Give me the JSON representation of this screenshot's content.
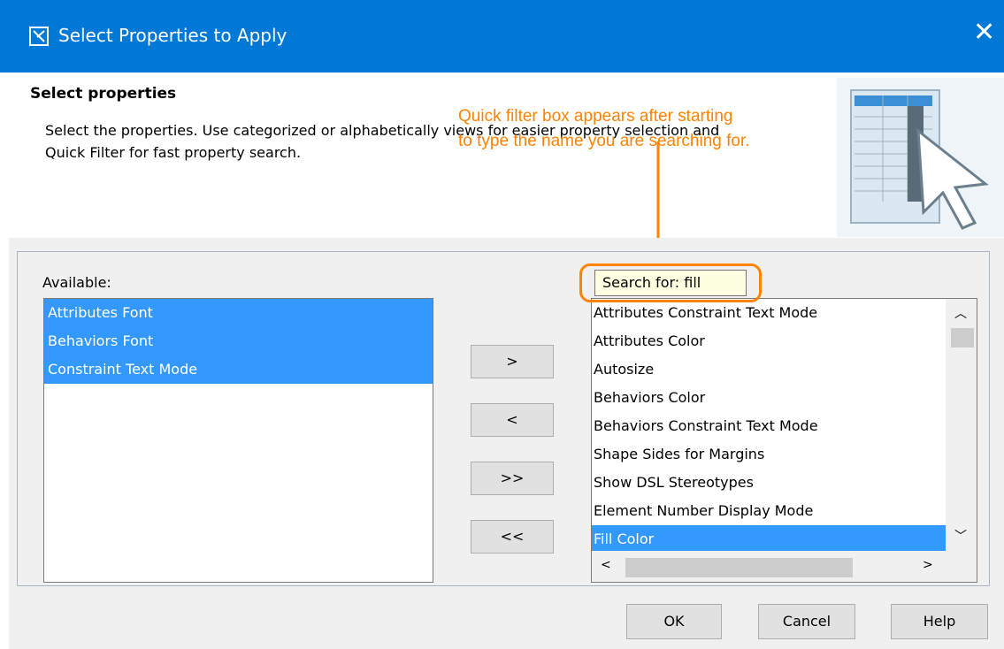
{
  "window": {
    "title": "Select Properties to Apply",
    "close_glyph": "✕"
  },
  "header": {
    "heading": "Select properties",
    "description": "Select the properties. Use categorized or alphabetically views for easier property selection and Quick Filter for fast property search."
  },
  "annotation": {
    "line1": "Quick filter box appears after starting",
    "line2": "to type the name you are searching for.",
    "color": "#ff8200"
  },
  "available": {
    "label": "Available:",
    "items": [
      "Attributes Font",
      "Behaviors Font",
      "Constraint Text Mode"
    ]
  },
  "move_buttons": {
    "add": ">",
    "remove": "<",
    "add_all": ">>",
    "remove_all": "<<"
  },
  "selected": {
    "search_text": "Search for: fill",
    "items": [
      "Attributes Constraint Text Mode",
      "Attributes Color",
      "Autosize",
      "Behaviors Color",
      "Behaviors Constraint Text Mode",
      "Shape Sides for Margins",
      "Show DSL Stereotypes",
      "Element Number Display Mode",
      "Fill Color"
    ],
    "selected_item": "Fill Color"
  },
  "dialog_buttons": {
    "ok": "OK",
    "cancel": "Cancel",
    "help": "Help"
  },
  "colors": {
    "titlebar": "#0078d7",
    "selection": "#3399ff"
  }
}
